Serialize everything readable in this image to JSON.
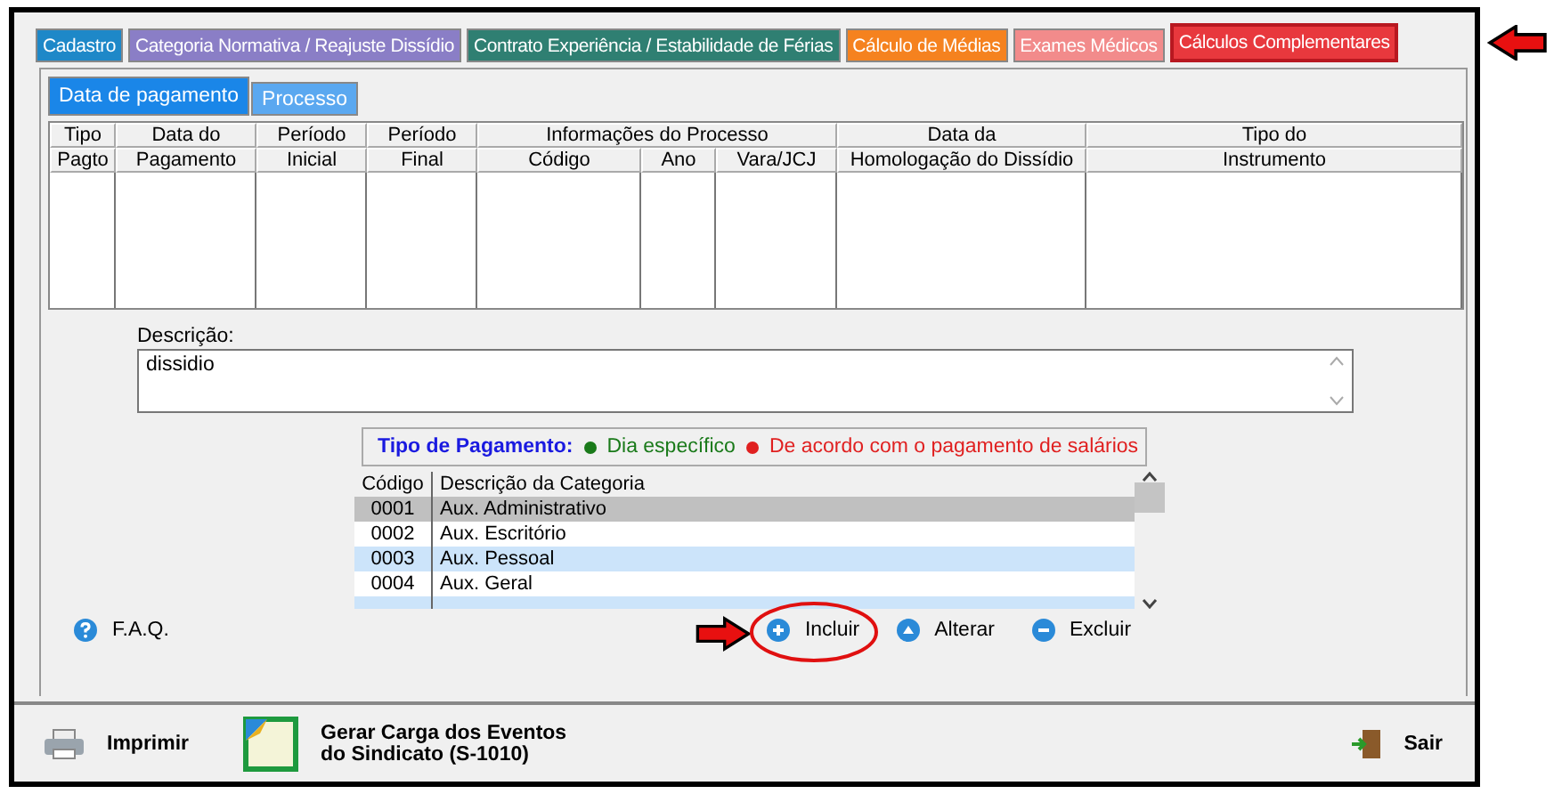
{
  "tabs": [
    {
      "label": "Cadastro",
      "color": "#1e88c8",
      "selected": false
    },
    {
      "label": "Categoria Normativa / Reajuste Dissídio",
      "color": "#8a7ec6",
      "selected": false
    },
    {
      "label": "Contrato Experiência / Estabilidade de Férias",
      "color": "#2f7f72",
      "selected": false
    },
    {
      "label": "Cálculo de Médias",
      "color": "#f5821f",
      "selected": false
    },
    {
      "label": "Exames Médicos",
      "color": "#f28b8b",
      "selected": false
    },
    {
      "label": "Cálculos Complementares",
      "color": "#e8383d",
      "selected": true
    }
  ],
  "subtabs": [
    {
      "label": "Data de pagamento",
      "selected": true
    },
    {
      "label": "Processo",
      "selected": false
    }
  ],
  "table": {
    "columns": [
      {
        "top": "Tipo",
        "bottom": "Pagto"
      },
      {
        "top": "Data do",
        "bottom": "Pagamento"
      },
      {
        "top": "Período",
        "bottom": "Inicial"
      },
      {
        "top": "Período",
        "bottom": "Final"
      },
      {
        "group": "Informações do Processo",
        "subs": [
          "Código",
          "Ano",
          "Vara/JCJ"
        ]
      },
      {
        "top": "Data da",
        "bottom": "Homologação do Dissídio"
      },
      {
        "top": "Tipo do",
        "bottom": "Instrumento"
      }
    ]
  },
  "description": {
    "label": "Descrição:",
    "value": "dissidio"
  },
  "payment_type": {
    "label": "Tipo de Pagamento:",
    "options": [
      {
        "label": "Dia específico",
        "color": "#1a7a1a"
      },
      {
        "label": "De acordo com o pagamento de salários",
        "color": "#e02020"
      }
    ]
  },
  "category_list": {
    "columns": [
      "Código",
      "Descrição da Categoria"
    ],
    "rows": [
      {
        "code": "0001",
        "name": "Aux. Administrativo",
        "selected": true
      },
      {
        "code": "0002",
        "name": "Aux. Escritório",
        "selected": false
      },
      {
        "code": "0003",
        "name": "Aux. Pessoal",
        "selected": false
      },
      {
        "code": "0004",
        "name": "Aux. Geral",
        "selected": false
      }
    ]
  },
  "faq": "F.A.Q.",
  "actions": [
    {
      "label": "Incluir",
      "kind": "plus",
      "highlighted": true
    },
    {
      "label": "Alterar",
      "kind": "up",
      "highlighted": false
    },
    {
      "label": "Excluir",
      "kind": "minus",
      "highlighted": false
    }
  ],
  "footer": {
    "print": "Imprimir",
    "generate": [
      "Gerar Carga dos Eventos",
      "do Sindicato (S-1010)"
    ],
    "exit": "Sair"
  }
}
